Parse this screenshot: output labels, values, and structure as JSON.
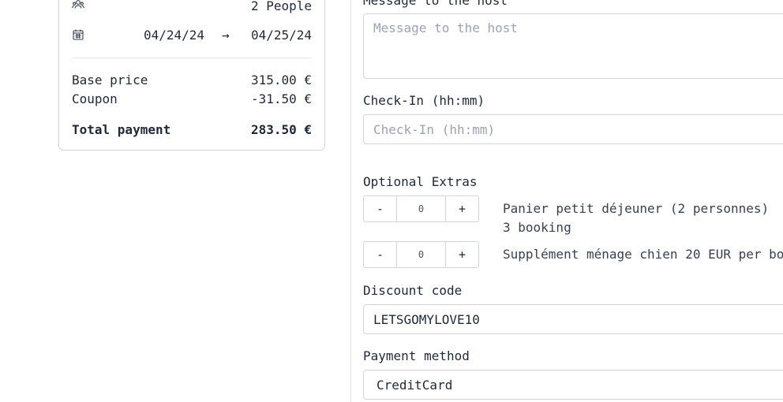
{
  "summary": {
    "guests": "2 People",
    "date_from": "04/24/24",
    "date_to": "04/25/24",
    "arrow": "→",
    "base_price_label": "Base price",
    "base_price_value": "315.00 €",
    "coupon_label": "Coupon",
    "coupon_value": "-31.50 €",
    "total_label": "Total payment",
    "total_value": "283.50 €"
  },
  "form": {
    "message_label": "Message to the host",
    "message_placeholder": "Message to the host",
    "checkin_label": "Check-In (hh:mm)",
    "checkin_placeholder": "Check-In (hh:mm)",
    "extras_label": "Optional Extras",
    "extras": [
      {
        "minus": "-",
        "qty": "0",
        "plus": "+",
        "text": "Panier petit déjeuner (2 personnes) 3 booking"
      },
      {
        "minus": "-",
        "qty": "0",
        "plus": "+",
        "text": "Supplément ménage chien 20 EUR per bo"
      }
    ],
    "discount_label": "Discount code",
    "discount_value": "LETSGOMYLOVE10",
    "payment_label": "Payment method",
    "payment_value": "CreditCard"
  },
  "icons": {
    "guests": "users-icon",
    "calendar": "calendar-icon"
  }
}
